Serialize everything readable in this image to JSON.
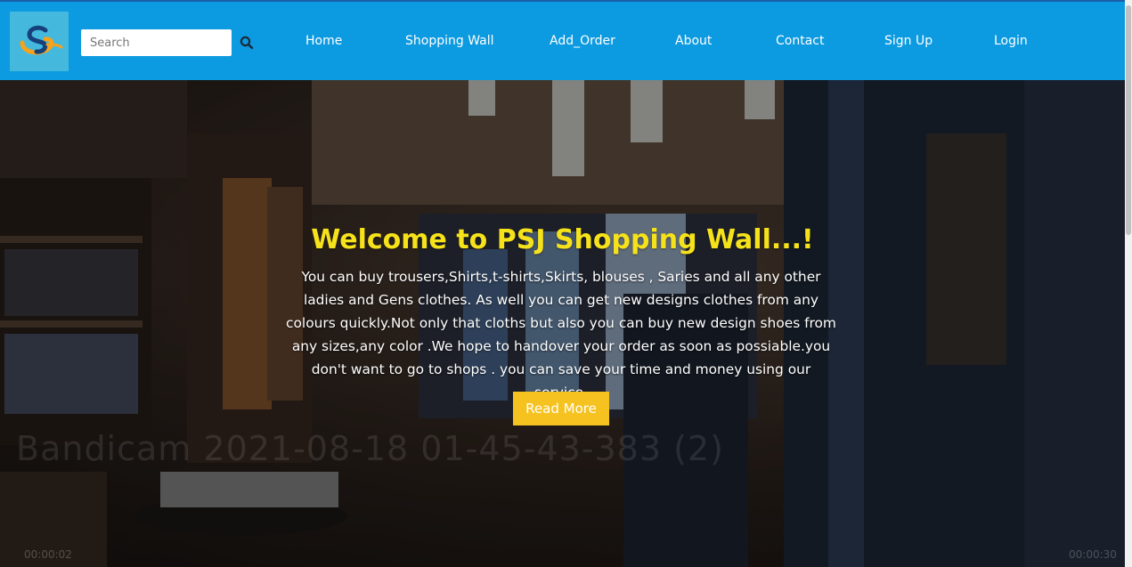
{
  "nav": {
    "logo_letter": "S",
    "search": {
      "placeholder": "Search",
      "value": ""
    },
    "search_icon": "search-icon",
    "links": [
      "Home",
      "Shopping Wall",
      "Add_Order",
      "About",
      "Contact",
      "Sign Up",
      "Login"
    ]
  },
  "hero": {
    "title": "Welcome to PSJ Shopping Wall...!",
    "text": "You can buy trousers,Shirts,t-shirts,Skirts, blouses , Saries and all any other ladies and Gens clothes. As well you can get new designs clothes from any colours quickly.Not only that cloths but also you can buy new design shoes from any sizes,any color .We hope to handover your order as soon as possiable.you don't want to go to shops . you can save your time and money using our service.",
    "button_label": "Read More",
    "watermark": "Bandicam 2021-08-18 01-45-43-383 (2)",
    "time_elapsed": "00:00:02",
    "time_total": "00:00:30"
  },
  "colors": {
    "navbar": "#0c9ae0",
    "title": "#f6e21a",
    "button": "#f6c220"
  }
}
